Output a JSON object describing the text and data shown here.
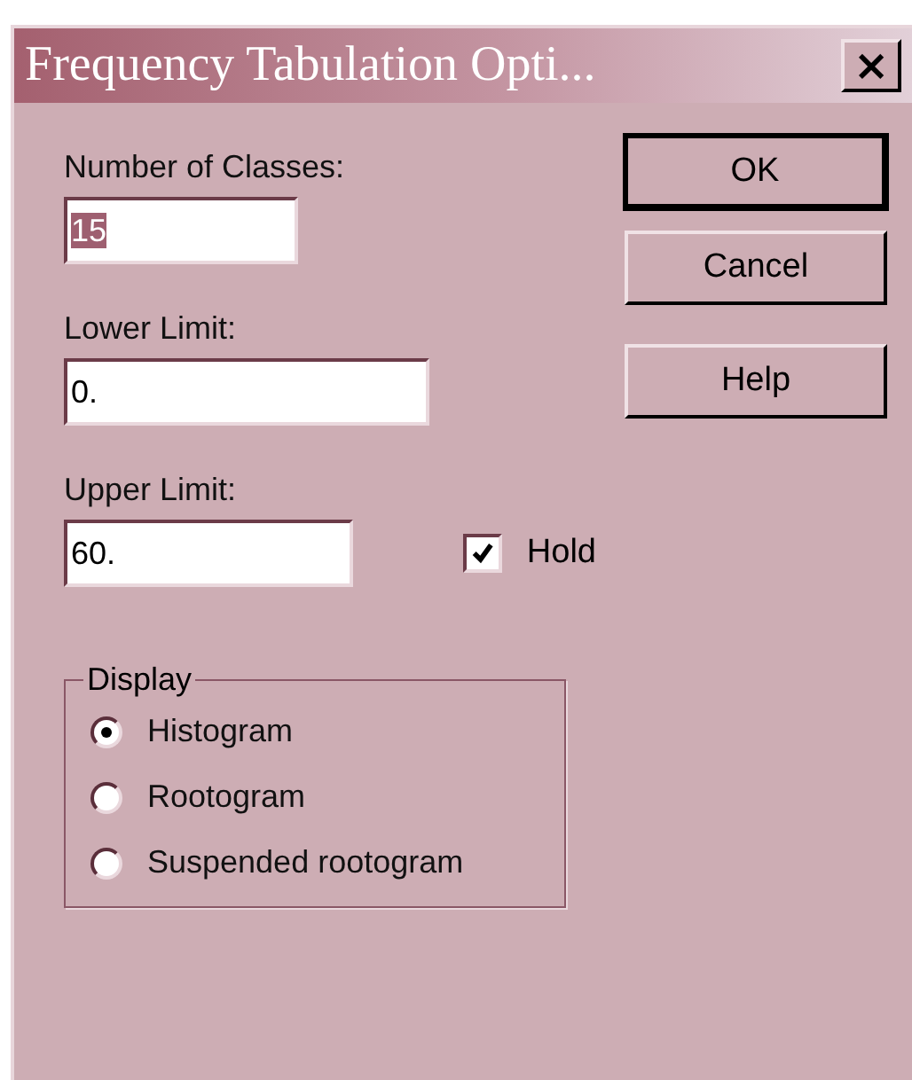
{
  "window": {
    "title": "Frequency Tabulation Opti...",
    "close": "×"
  },
  "fields": [
    {
      "label": "Number of Classes:",
      "value": "15",
      "text_selected": true,
      "kind": "short"
    },
    {
      "label": "Lower Limit:",
      "value": "0.",
      "text_selected": false,
      "kind": "long"
    },
    {
      "label": "Upper Limit:",
      "value": "60.",
      "text_selected": false,
      "kind": "long"
    }
  ],
  "hold": {
    "label": "Hold",
    "checked": true
  },
  "buttons": [
    {
      "label": "OK",
      "default": true
    },
    {
      "label": "Cancel",
      "default": false
    },
    {
      "label": "Help",
      "default": false
    }
  ],
  "display": {
    "title": "Display",
    "options": [
      {
        "label": "Histogram",
        "selected": true
      },
      {
        "label": "Rootogram",
        "selected": false
      },
      {
        "label": "Suspended rootogram",
        "selected": false
      }
    ]
  }
}
